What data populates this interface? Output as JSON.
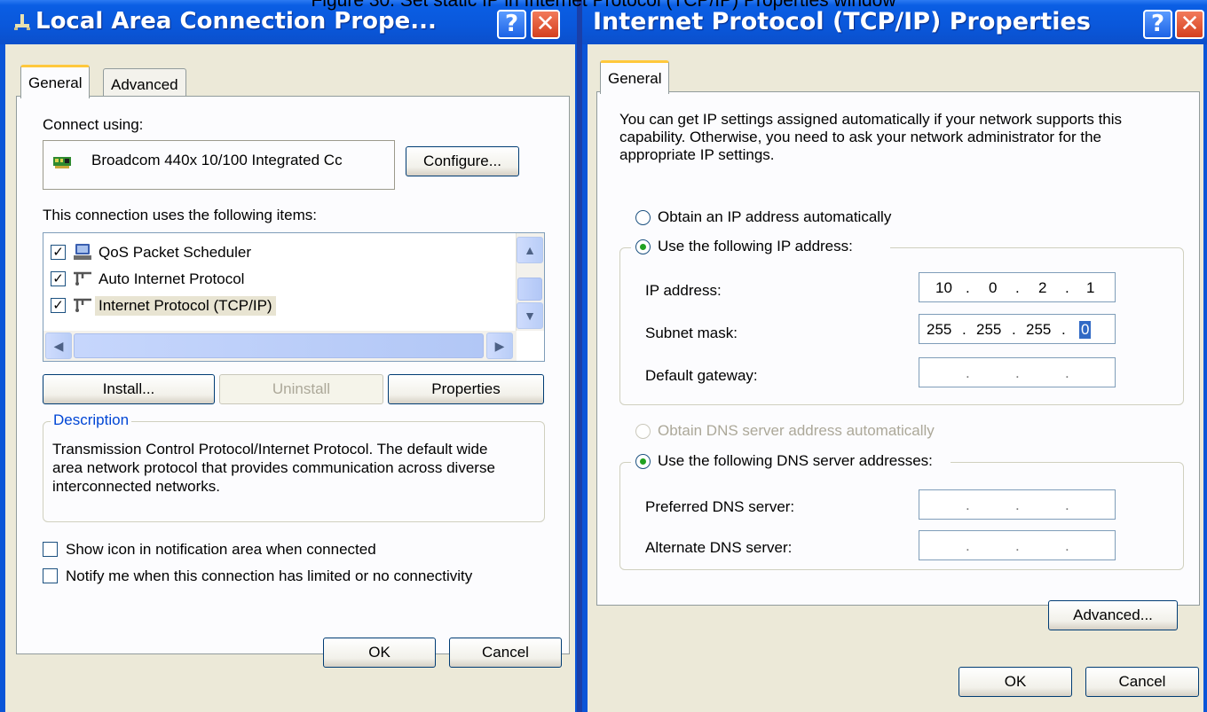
{
  "caption": "Figure 30. Set static IP in Internet Protocol (TCP/IP) Properties window",
  "left_window": {
    "title": "Local Area Connection Prope...",
    "title_icon": "network-connection-icon",
    "help_label": "?",
    "close_label": "✕",
    "tabs": [
      "General",
      "Advanced"
    ],
    "connect_using_label": "Connect using:",
    "adapter_name": "Broadcom 440x 10/100 Integrated Cc",
    "configure_label": "Configure...",
    "items_label": "This connection uses the following items:",
    "items": [
      {
        "label": "QoS Packet Scheduler",
        "checked": true,
        "icon": "scheduler-icon",
        "check_mark": "✓"
      },
      {
        "label": "Auto Internet Protocol",
        "checked": true,
        "icon": "protocol-icon",
        "check_mark": "✓"
      },
      {
        "label": "Internet Protocol (TCP/IP)",
        "checked": true,
        "icon": "protocol-icon",
        "check_mark": "✓",
        "selected": true
      }
    ],
    "install_label": "Install...",
    "uninstall_label": "Uninstall",
    "properties_label": "Properties",
    "description_title": "Description",
    "description_text": "Transmission Control Protocol/Internet Protocol. The default wide area network protocol that provides communication across diverse interconnected networks.",
    "show_icon_label": "Show icon in notification area when connected",
    "notify_label": "Notify me when this connection has limited or no connectivity",
    "ok_label": "OK",
    "cancel_label": "Cancel"
  },
  "right_window": {
    "title": "Internet Protocol (TCP/IP) Properties",
    "help_label": "?",
    "close_label": "✕",
    "tab": "General",
    "intro_text": "You can get IP settings assigned automatically if your network supports this capability. Otherwise, you need to ask your network administrator for the appropriate IP settings.",
    "obtain_ip_label": "Obtain an IP address automatically",
    "use_ip_label": "Use the following IP address:",
    "ip_address_label": "IP address:",
    "ip_address": [
      "10",
      "0",
      "2",
      "1"
    ],
    "subnet_label": "Subnet mask:",
    "subnet_mask": [
      "255",
      "255",
      "255",
      "0"
    ],
    "gateway_label": "Default gateway:",
    "obtain_dns_label": "Obtain DNS server address automatically",
    "use_dns_label": "Use the following DNS server addresses:",
    "preferred_dns_label": "Preferred DNS server:",
    "alternate_dns_label": "Alternate DNS server:",
    "ip_separator": ".",
    "advanced_label": "Advanced...",
    "ok_label": "OK",
    "cancel_label": "Cancel"
  },
  "colors": {
    "titlebar": "#0a57da",
    "dialog_face": "#ece9d8",
    "radio_dot": "#21a121",
    "active_tab_accent": "#ffc83c"
  }
}
